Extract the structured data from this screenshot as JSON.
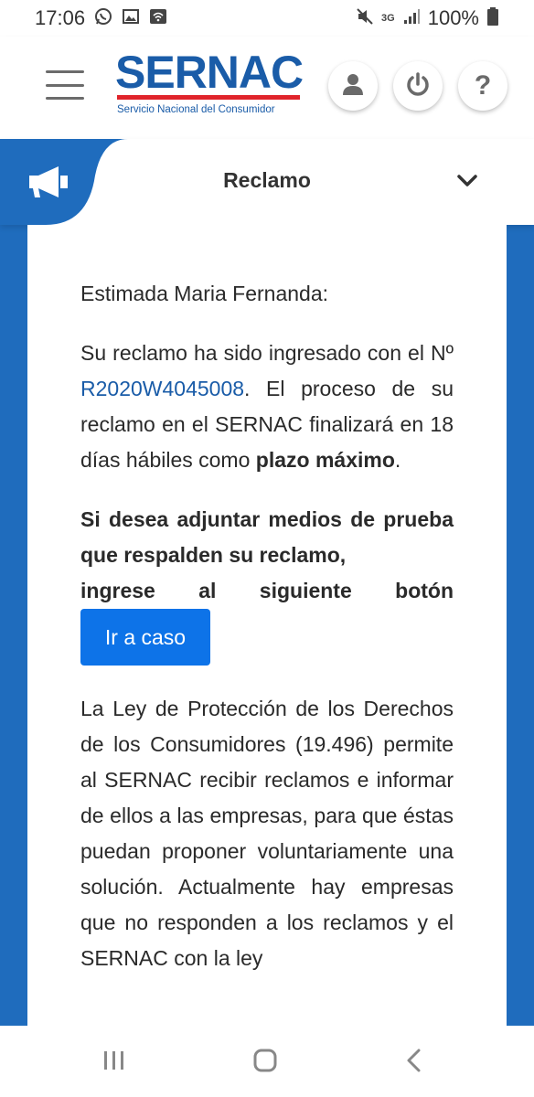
{
  "status_bar": {
    "time": "17:06",
    "network": "3G",
    "battery": "100%",
    "icons": [
      "whatsapp-icon",
      "gallery-icon",
      "wifi-calling-icon",
      "mute-icon",
      "signal-icon",
      "battery-icon"
    ]
  },
  "header": {
    "logo_text": "SERNAC",
    "logo_subtitle": "Servicio Nacional del Consumidor",
    "buttons": [
      "user-icon",
      "power-icon",
      "help-icon"
    ],
    "help_glyph": "?"
  },
  "section": {
    "title": "Reclamo",
    "icon": "megaphone-icon"
  },
  "content": {
    "greeting": "Estimada Maria Fernanda:",
    "p1_before": "Su reclamo ha sido ingresado con el Nº ",
    "case_number": "R2020W4045008",
    "p1_after": ". El proceso de su reclamo en el SERNAC finalizará en 18 días hábiles como ",
    "p1_bold": "plazo máximo",
    "p1_end": ".",
    "p2_main": "Si desea adjuntar medios de prueba que respalden su reclamo, ",
    "p2_last": "ingrese al siguiente botón",
    "case_button": "Ir a caso",
    "p3": "La Ley de Protección de los Derechos de los Consumidores (19.496) permite al SERNAC recibir reclamos e informar de ellos a las empresas, para que éstas puedan proponer voluntariamente una solución. Actualmente hay empresas que no responden a los reclamos y el SERNAC con la ley"
  },
  "colors": {
    "brand_blue": "#1a5ca8",
    "brand_red": "#e0242b",
    "frame_blue": "#1f6cbd",
    "button_blue": "#0d73e8"
  },
  "nav": [
    "recent-apps-icon",
    "home-icon",
    "back-icon"
  ]
}
